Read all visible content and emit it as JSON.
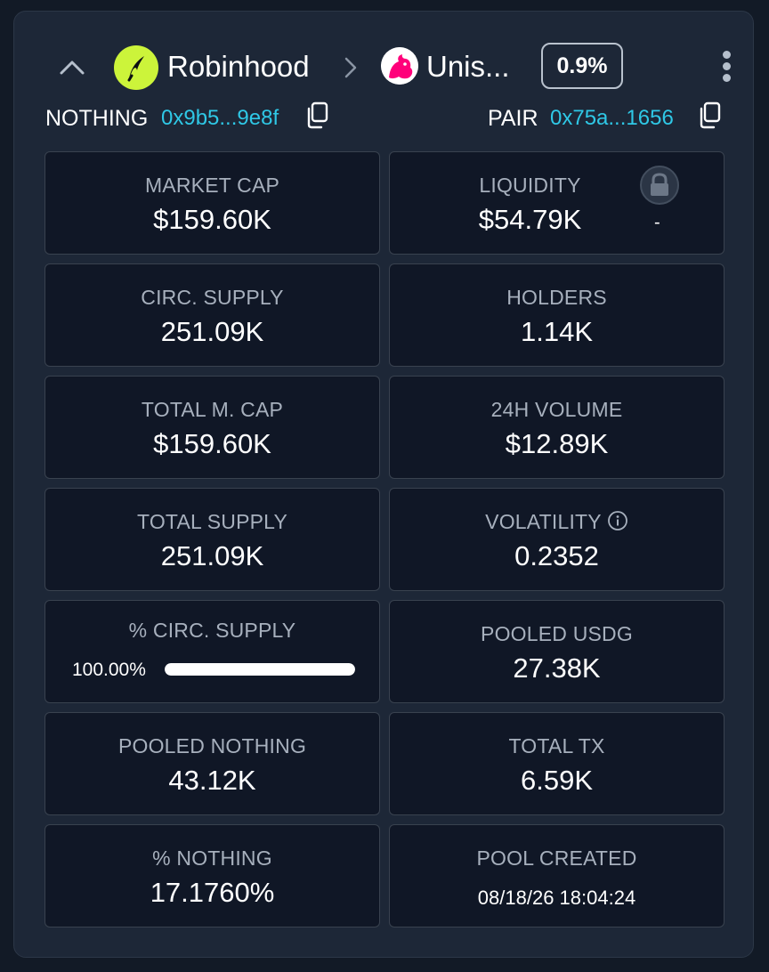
{
  "header": {
    "dex_name": "Robinhood",
    "pair_name": "Unis...",
    "fee": "0.9%"
  },
  "addresses": {
    "token_label": "NOTHING",
    "token_address": "0x9b5...9e8f",
    "pair_label": "PAIR",
    "pair_address": "0x75a...1656"
  },
  "stats": {
    "market_cap": {
      "label": "MARKET CAP",
      "value": "$159.60K"
    },
    "liquidity": {
      "label": "LIQUIDITY",
      "value": "$54.79K",
      "lock_status": "-"
    },
    "circ_supply": {
      "label": "CIRC. SUPPLY",
      "value": "251.09K"
    },
    "holders": {
      "label": "HOLDERS",
      "value": "1.14K"
    },
    "total_mcap": {
      "label": "TOTAL M. CAP",
      "value": "$159.60K"
    },
    "volume_24h": {
      "label": "24H VOLUME",
      "value": "$12.89K"
    },
    "total_supply": {
      "label": "TOTAL SUPPLY",
      "value": "251.09K"
    },
    "volatility": {
      "label": "VOLATILITY",
      "value": "0.2352"
    },
    "pct_circ_supply": {
      "label": "% CIRC. SUPPLY",
      "value": "100.00%",
      "fraction": 1.0
    },
    "pooled_usdg": {
      "label": "POOLED USDG",
      "value": "27.38K"
    },
    "pooled_nothing": {
      "label": "POOLED NOTHING",
      "value": "43.12K"
    },
    "total_tx": {
      "label": "TOTAL TX",
      "value": "6.59K"
    },
    "pct_nothing": {
      "label": "% NOTHING",
      "value": "17.1760%"
    },
    "pool_created": {
      "label": "POOL CREATED",
      "value": "08/18/26 18:04:24"
    }
  },
  "icons": {
    "collapse": "chevron-up-icon",
    "separator": "chevron-right-icon",
    "menu": "kebab-menu-icon",
    "copy": "copy-icon",
    "lock": "lock-icon",
    "info": "info-icon"
  },
  "colors": {
    "background": "#121a26",
    "panel": "#1d2737",
    "card": "#101726",
    "accent_address": "#2fc8e6",
    "robinhood_green": "#ccf43a",
    "uniswap_pink": "#ff007a",
    "label_gray": "#a7b0bd"
  }
}
